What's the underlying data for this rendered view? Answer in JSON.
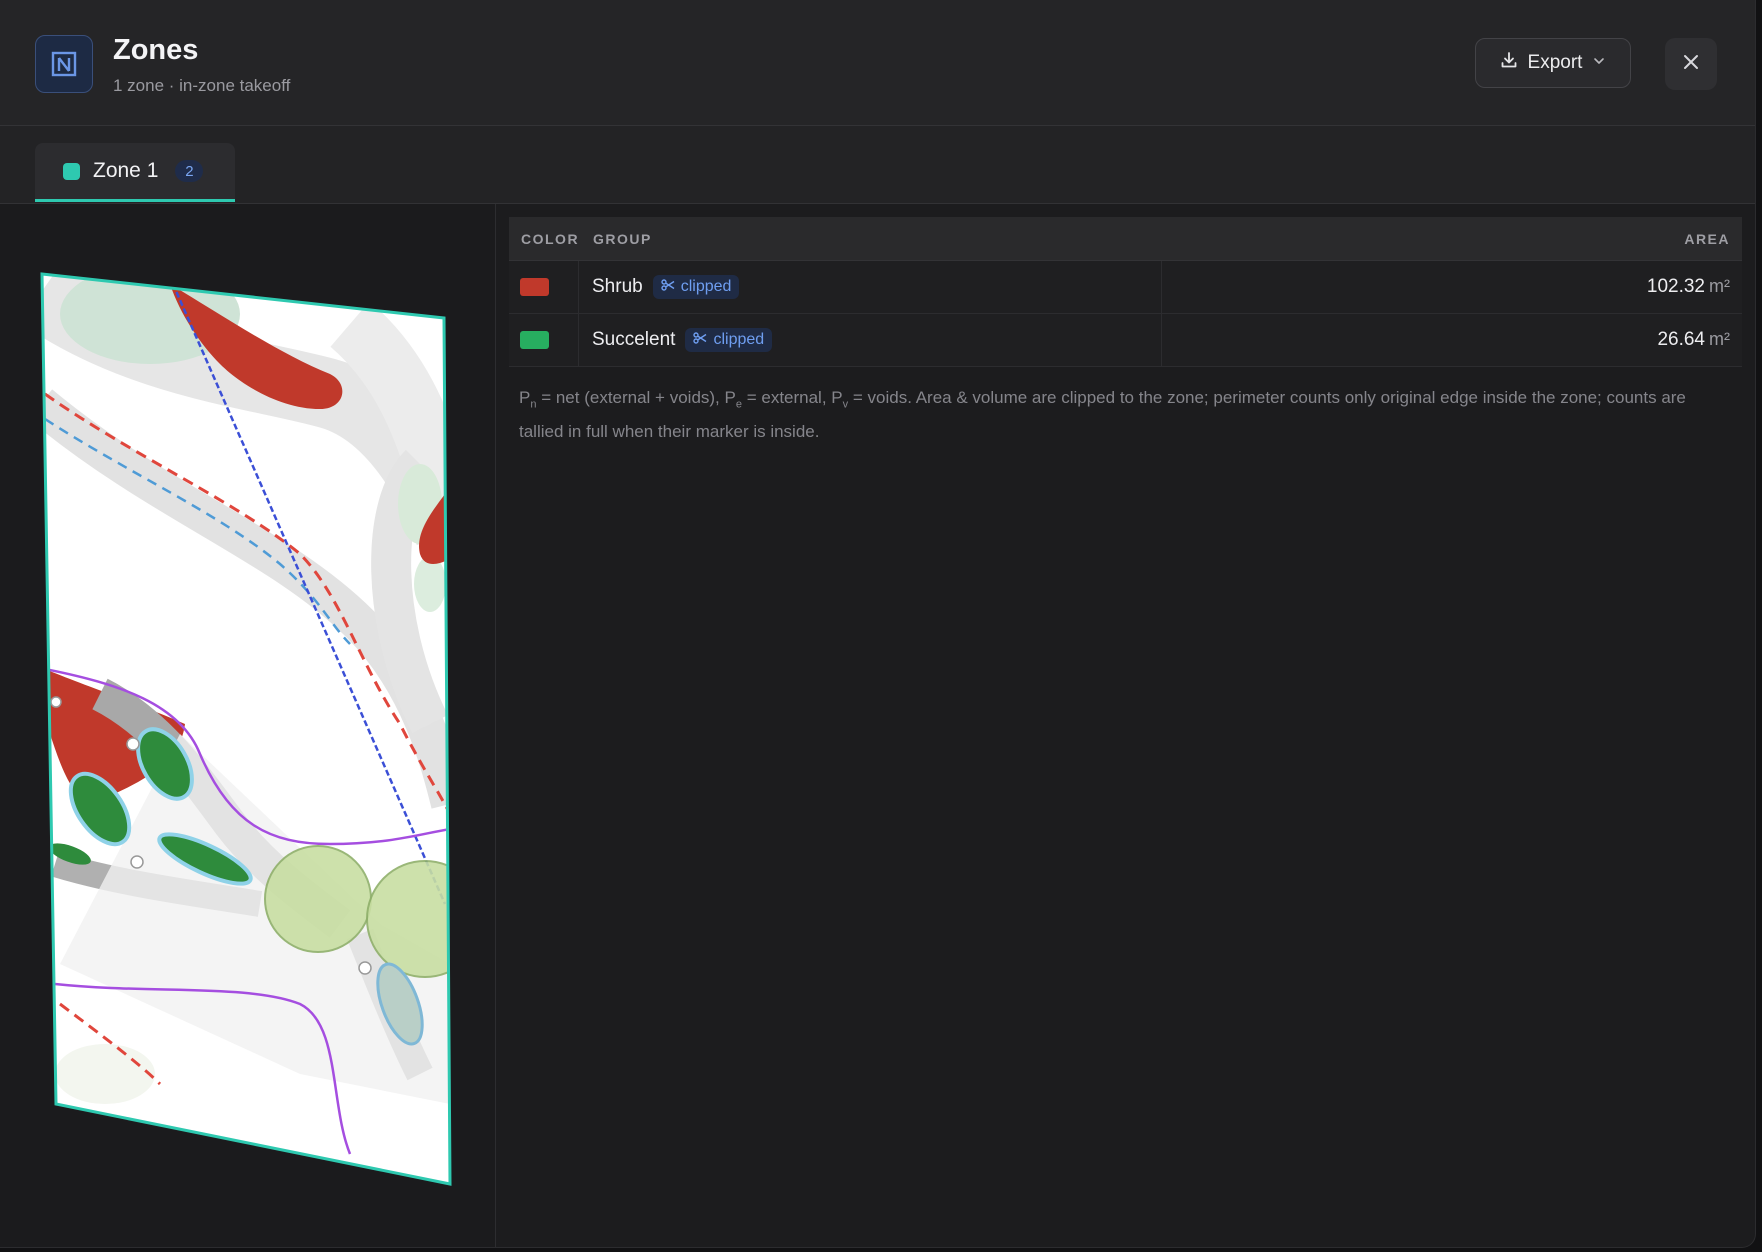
{
  "header": {
    "title": "Zones",
    "subtitle": "1 zone · in-zone takeoff",
    "export_label": "Export"
  },
  "tabs": [
    {
      "label": "Zone 1",
      "count": "2",
      "color": "#2ec9b0"
    }
  ],
  "table": {
    "columns": {
      "color": "COLOR",
      "group": "GROUP",
      "area": "AREA"
    },
    "rows": [
      {
        "group": "Shrub",
        "badge": "clipped",
        "area": "102.32",
        "unit": "m²",
        "color": "#c0392b"
      },
      {
        "group": "Succelent",
        "badge": "clipped",
        "area": "26.64",
        "unit": "m²",
        "color": "#27ae60"
      }
    ]
  },
  "legend_note": {
    "pn": "n",
    "pe": "e",
    "pv": "v",
    "part1": " = net (external + voids), ",
    "part2": " = external, ",
    "part3": " = voids. Area & volume are clipped to the zone; perimeter counts only original edge inside the zone; counts are tallied in full when their marker is inside."
  },
  "icons": {
    "app": "zones-icon",
    "export": "download-icon",
    "chevron": "chevron-down-icon",
    "close": "close-icon",
    "clip": "scissors-icon"
  }
}
